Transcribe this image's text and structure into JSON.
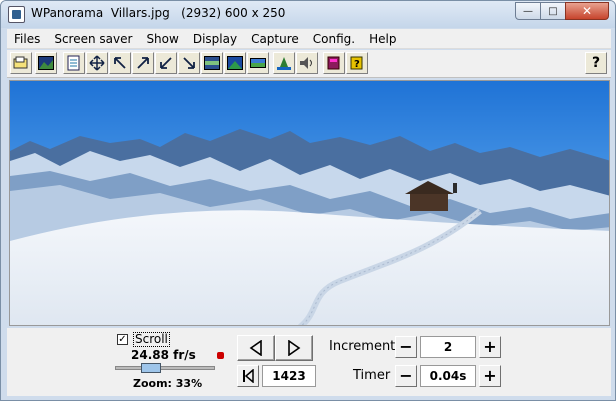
{
  "window": {
    "title": "WPanorama  Villars.jpg   (2932) 600 x 250",
    "minimize_symbol": "—",
    "maximize_symbol": "□",
    "close_symbol": "✕"
  },
  "menu": [
    "Files",
    "Screen saver",
    "Show",
    "Display",
    "Capture",
    "Config.",
    "Help"
  ],
  "toolbar": {
    "icons": [
      "open-icon",
      "picture-icon",
      "document-icon",
      "move-icon",
      "arrow-nw-icon",
      "arrow-ne-icon",
      "arrow-sw-icon",
      "arrow-se-icon",
      "strip-icon",
      "fit-icon",
      "wide-icon",
      "level-icon",
      "sound-icon",
      "book-icon",
      "help-book-icon"
    ],
    "help_label": "?"
  },
  "panel": {
    "scroll_checked": "✓",
    "scroll_label": "Scroll",
    "fps": "24.88 fr/s",
    "zoom_label": "Zoom: 33%",
    "zoom_fraction": 0.33,
    "position_value": "1423",
    "increment_label": "Increment",
    "increment_value": "2",
    "timer_label": "Timer",
    "timer_value": "0.04s",
    "minus": "−",
    "plus": "+"
  }
}
